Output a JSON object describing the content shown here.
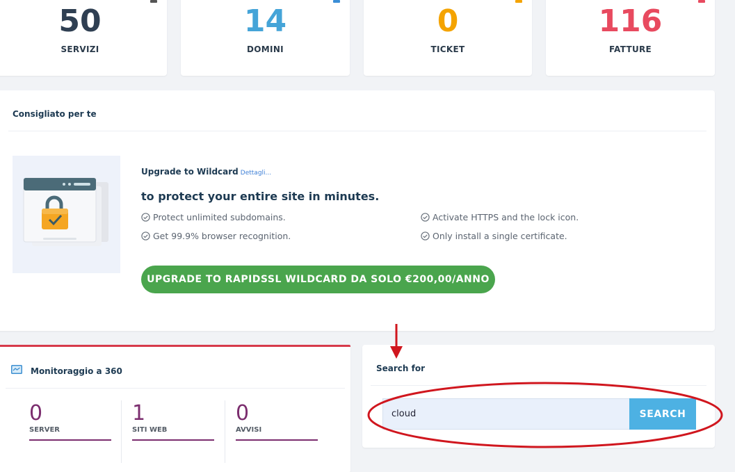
{
  "stats": [
    {
      "value": "50",
      "label": "SERVIZI",
      "color": "#2f3f52",
      "accent": "#555"
    },
    {
      "value": "14",
      "label": "DOMINI",
      "color": "#45a4d8",
      "accent": "#3b8ed6"
    },
    {
      "value": "0",
      "label": "TICKET",
      "color": "#f4a300",
      "accent": "#f4a300"
    },
    {
      "value": "116",
      "label": "FATTURE",
      "color": "#e84a5f",
      "accent": "#e84a5f"
    }
  ],
  "recommended": {
    "title": "Consigliato per te",
    "upgrade_title": "Upgrade to Wildcard",
    "details_link": "Dettagli...",
    "headline": "to protect your entire site in minutes.",
    "features": [
      "Protect unlimited subdomains.",
      "Get 99.9% browser recognition.",
      "Activate HTTPS and the lock icon.",
      "Only install a single certificate."
    ],
    "button_label": "UPGRADE TO RAPIDSSL WILDCARD DA SOLO €200,00/ANNO",
    "button_color": "#4aa54d"
  },
  "monitoring": {
    "title": "Monitoraggio a 360",
    "accent": "#d73a4a",
    "items": [
      {
        "value": "0",
        "label": "SERVER"
      },
      {
        "value": "1",
        "label": "SITI WEB"
      },
      {
        "value": "0",
        "label": "AVVISI"
      }
    ]
  },
  "search": {
    "title": "Search for",
    "value": "cloud",
    "button_label": "SEARCH",
    "button_color": "#4db1e3"
  },
  "icons": [
    "check-circle-icon",
    "monitor-icon",
    "ssl-lock-illustration",
    "arrow-down-annotation",
    "ellipse-annotation"
  ]
}
